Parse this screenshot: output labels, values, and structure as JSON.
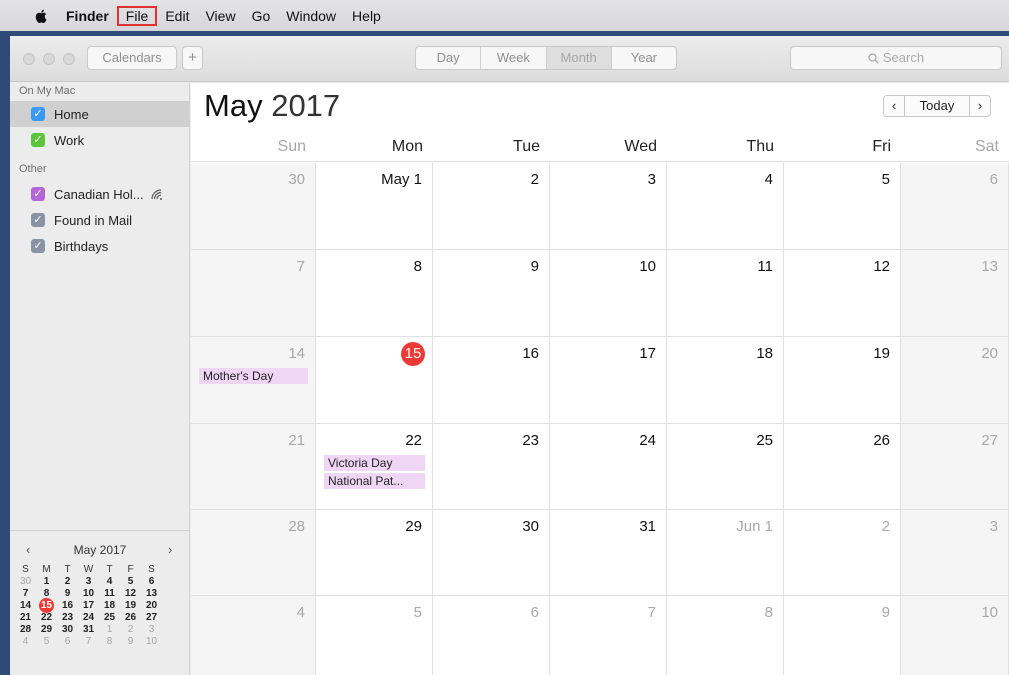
{
  "menubar": {
    "apple_icon": "apple-logo-icon",
    "items": [
      "Finder",
      "File",
      "Edit",
      "View",
      "Go",
      "Window",
      "Help"
    ]
  },
  "toolbar": {
    "calendars_label": "Calendars",
    "add_label": "+",
    "views": [
      "Day",
      "Week",
      "Month",
      "Year"
    ],
    "selected_view": "Month",
    "search_placeholder": "Search"
  },
  "sidebar": {
    "sections": [
      {
        "label": "On My Mac",
        "items": [
          {
            "label": "Home",
            "color": "#3b99f2",
            "checked": true,
            "selected": true
          },
          {
            "label": "Work",
            "color": "#5ac43d",
            "checked": true
          }
        ]
      },
      {
        "label": "Other",
        "items": [
          {
            "label": "Canadian Hol...",
            "color": "#b366d6",
            "checked": true,
            "icon": "broadcast-icon"
          },
          {
            "label": "Found in Mail",
            "color": "#8a93a3",
            "checked": true
          },
          {
            "label": "Birthdays",
            "color": "#8a93a3",
            "checked": true
          }
        ]
      }
    ]
  },
  "mini_calendar": {
    "title": "May 2017",
    "prev": "‹",
    "next": "›",
    "weekdays": [
      "S",
      "M",
      "T",
      "W",
      "T",
      "F",
      "S"
    ],
    "weeks": [
      [
        "30",
        "1",
        "2",
        "3",
        "4",
        "5",
        "6"
      ],
      [
        "7",
        "8",
        "9",
        "10",
        "11",
        "12",
        "13"
      ],
      [
        "14",
        "15",
        "16",
        "17",
        "18",
        "19",
        "20"
      ],
      [
        "21",
        "22",
        "23",
        "24",
        "25",
        "26",
        "27"
      ],
      [
        "28",
        "29",
        "30",
        "31",
        "1",
        "2",
        "3"
      ],
      [
        "4",
        "5",
        "6",
        "7",
        "8",
        "9",
        "10"
      ]
    ],
    "today": "15"
  },
  "main": {
    "month": "May",
    "year": "2017",
    "nav": {
      "prev": "‹",
      "today": "Today",
      "next": "›"
    },
    "weekdays": [
      "Sun",
      "Mon",
      "Tue",
      "Wed",
      "Thu",
      "Fri",
      "Sat"
    ],
    "weeks": [
      [
        "30",
        "May 1",
        "2",
        "3",
        "4",
        "5",
        "6"
      ],
      [
        "7",
        "8",
        "9",
        "10",
        "11",
        "12",
        "13"
      ],
      [
        "14",
        "15",
        "16",
        "17",
        "18",
        "19",
        "20"
      ],
      [
        "21",
        "22",
        "23",
        "24",
        "25",
        "26",
        "27"
      ],
      [
        "28",
        "29",
        "30",
        "31",
        "Jun 1",
        "2",
        "3"
      ],
      [
        "4",
        "5",
        "6",
        "7",
        "8",
        "9",
        "10"
      ]
    ],
    "today": "15",
    "events": [
      {
        "week": 2,
        "day": 0,
        "label": "Mother's Day"
      },
      {
        "week": 3,
        "day": 1,
        "label": "Victoria Day"
      },
      {
        "week": 3,
        "day": 1,
        "label": "National Pat..."
      }
    ],
    "event_color": "#efd6f4",
    "today_color": "#ee3a35"
  }
}
